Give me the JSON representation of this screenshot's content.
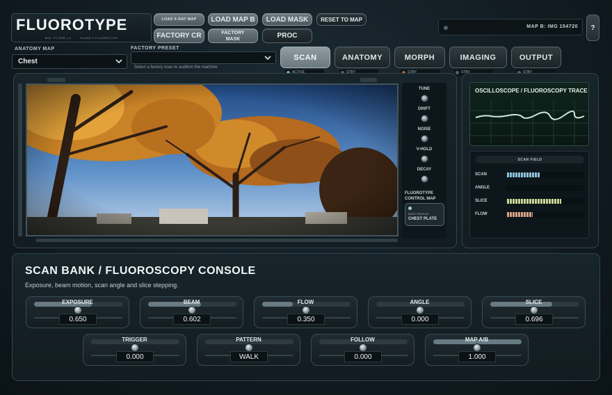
{
  "header": {
    "logo_title": "FLUOROTYPE",
    "logo_sub_left": "MIX: FT-OPR | A",
    "logo_sub_right": "CLASS II FLUOROTYPE",
    "buttons": {
      "load_xray_map": "LOAD X-RAY MAP",
      "load_map_b": "LOAD MAP B",
      "load_mask": "LOAD MASK",
      "reset_to_map": "RESET TO MAP",
      "factory_cr": "FACTORY CR",
      "factory_mask_line1": "FACTORY",
      "factory_mask_line2": "MASK",
      "proc": "PROC"
    },
    "map_b_text": "MAP B: IMG 154720",
    "help": "?"
  },
  "anatomy_map": {
    "label": "ANATOMY MAP",
    "value": "Chest"
  },
  "factory_preset": {
    "label": "FACTORY PRESET",
    "value": "",
    "hint": "Select a factory scan to audition the machine."
  },
  "tabs": [
    {
      "label": "SCAN",
      "status": "ACTIVE",
      "active": true,
      "led": "#5aa9d6"
    },
    {
      "label": "ANATOMY",
      "status": "STBY",
      "active": false,
      "led": "#56636a"
    },
    {
      "label": "MORPH",
      "status": "STBY",
      "active": false,
      "led": "#a0623a"
    },
    {
      "label": "IMAGING",
      "status": "STBY",
      "active": false,
      "led": "#56636a"
    },
    {
      "label": "OUTPUT",
      "status": "STBY",
      "active": false,
      "led": "#56636a"
    }
  ],
  "viewer": {
    "knobs": [
      "TUNE",
      "DRIFT",
      "NOISE",
      "V-HOLD",
      "DECAY"
    ],
    "control_map_title_1": "FLUOROTYPE",
    "control_map_title_2": "CONTROL MAP",
    "body_profile_label": "BODY PROFILE",
    "body_profile_value": "CHEST PLATE"
  },
  "scope": {
    "title": "OSCILLOSCOPE / FLUOROSCOPY TRACE",
    "scan_field_title": "SCAN FIELD",
    "rows": [
      {
        "label": "SCAN",
        "level": 0.42,
        "color": "#8fc3dc"
      },
      {
        "label": "ANGLE",
        "level": 0.0,
        "color": "#8fc3dc"
      },
      {
        "label": "SLICE",
        "level": 0.7,
        "color": "#c9d79a"
      },
      {
        "label": "FLOW",
        "level": 0.33,
        "color": "#d9a68b"
      }
    ]
  },
  "console": {
    "title": "SCAN BANK / FLUOROSCOPY CONSOLE",
    "subtitle": "Exposure, beam motion, scan angle and slice stepping.",
    "knobs_row1": [
      {
        "label": "EXPOSURE",
        "value": "0.650",
        "level": 0.65
      },
      {
        "label": "BEAM",
        "value": "0.602",
        "level": 0.6
      },
      {
        "label": "FLOW",
        "value": "0.350",
        "level": 0.35
      },
      {
        "label": "ANGLE",
        "value": "0.000",
        "level": 0.0
      },
      {
        "label": "SLICE",
        "value": "0.696",
        "level": 0.7
      }
    ],
    "knobs_row2": [
      {
        "label": "TRIGGER",
        "value": "0.000",
        "level": 0.0
      },
      {
        "label": "PATTERN",
        "value": "WALK",
        "level": 0.0
      },
      {
        "label": "FOLLOW",
        "value": "0.000",
        "level": 0.0
      },
      {
        "label": "MAP A/B",
        "value": "1.000",
        "level": 1.0
      }
    ]
  }
}
